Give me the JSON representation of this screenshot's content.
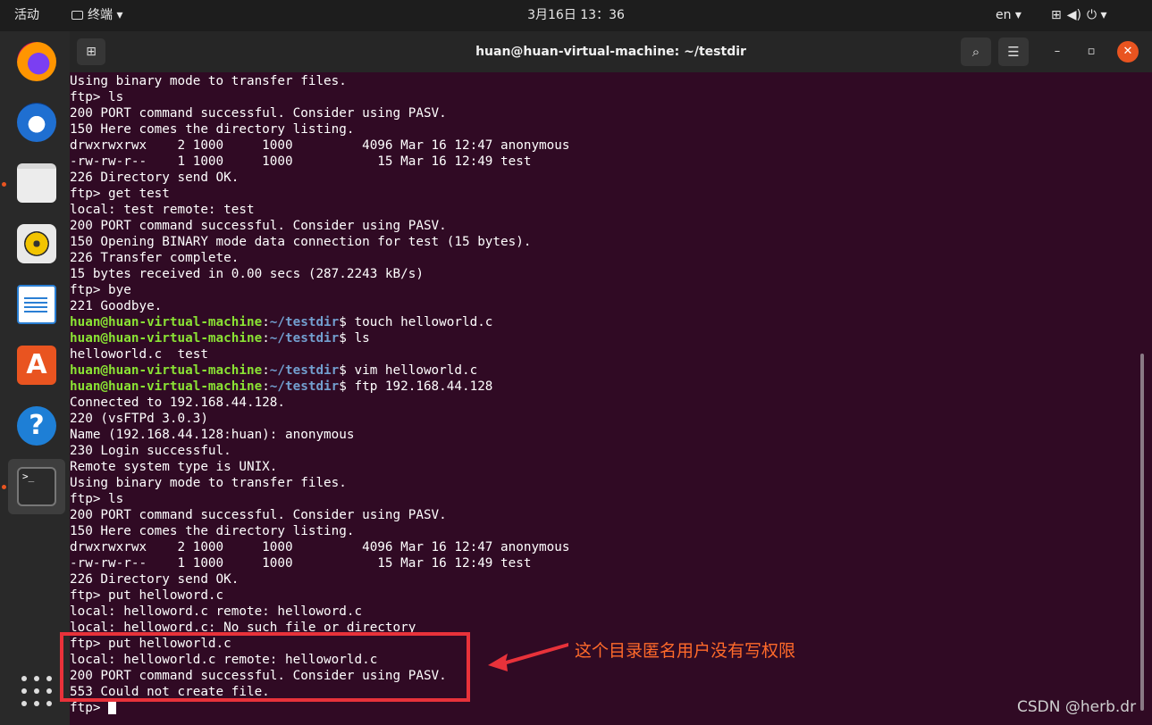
{
  "topbar": {
    "activities": "活动",
    "app_menu": "终端 ▾",
    "clock": "3月16日  13：36",
    "lang": "en ▾",
    "tray": [
      "network-icon",
      "volume-icon",
      "power-icon"
    ]
  },
  "dock": {
    "apps": [
      "firefox-icon",
      "thunderbird-icon",
      "files-icon",
      "rhythmbox-icon",
      "libreoffice-writer-icon",
      "app-store-icon",
      "help-icon",
      "terminal-icon"
    ],
    "store_glyph": "A",
    "help_glyph": "?",
    "terminal_glyph": ">_"
  },
  "window": {
    "title": "huan@huan-virtual-machine: ~/testdir",
    "new_tab": "⊞",
    "search": "⌕",
    "menu": "☰",
    "minimize": "–",
    "maximize": "▫",
    "close": "✕"
  },
  "prompt": {
    "user": "huan@huan-virtual-machine",
    "colon": ":",
    "path": "~/testdir",
    "dollar": "$ "
  },
  "terminal_lines": [
    "Using binary mode to transfer files.",
    "ftp> ls",
    "200 PORT command successful. Consider using PASV.",
    "150 Here comes the directory listing.",
    "drwxrwxrwx    2 1000     1000         4096 Mar 16 12:47 anonymous",
    "-rw-rw-r--    1 1000     1000           15 Mar 16 12:49 test",
    "226 Directory send OK.",
    "ftp> get test",
    "local: test remote: test",
    "200 PORT command successful. Consider using PASV.",
    "150 Opening BINARY mode data connection for test (15 bytes).",
    "226 Transfer complete.",
    "15 bytes received in 0.00 secs (287.2243 kB/s)",
    "ftp> bye",
    "221 Goodbye.",
    "touch helloworld.c",
    "ls",
    "helloworld.c  test",
    "vim helloworld.c",
    "ftp 192.168.44.128",
    "Connected to 192.168.44.128.",
    "220 (vsFTPd 3.0.3)",
    "Name (192.168.44.128:huan): anonymous",
    "230 Login successful.",
    "Remote system type is UNIX.",
    "Using binary mode to transfer files.",
    "ftp> ls",
    "200 PORT command successful. Consider using PASV.",
    "150 Here comes the directory listing.",
    "drwxrwxrwx    2 1000     1000         4096 Mar 16 12:47 anonymous",
    "-rw-rw-r--    1 1000     1000           15 Mar 16 12:49 test",
    "226 Directory send OK.",
    "ftp> put helloword.c",
    "local: helloword.c remote: helloword.c",
    "local: helloword.c: No such file or directory",
    "ftp> put helloworld.c",
    "local: helloworld.c remote: helloworld.c",
    "200 PORT command successful. Consider using PASV.",
    "553 Could not create file.",
    "ftp> "
  ],
  "annotation": {
    "text": "这个目录匿名用户没有写权限",
    "color": "#ff6a2a",
    "box_color": "#e8323a"
  },
  "watermark": "CSDN @herb.dr",
  "colors": {
    "terminal_bg": "#300a24",
    "prompt_user": "#8ae234",
    "prompt_path": "#729fcf",
    "accent": "#e95420"
  }
}
